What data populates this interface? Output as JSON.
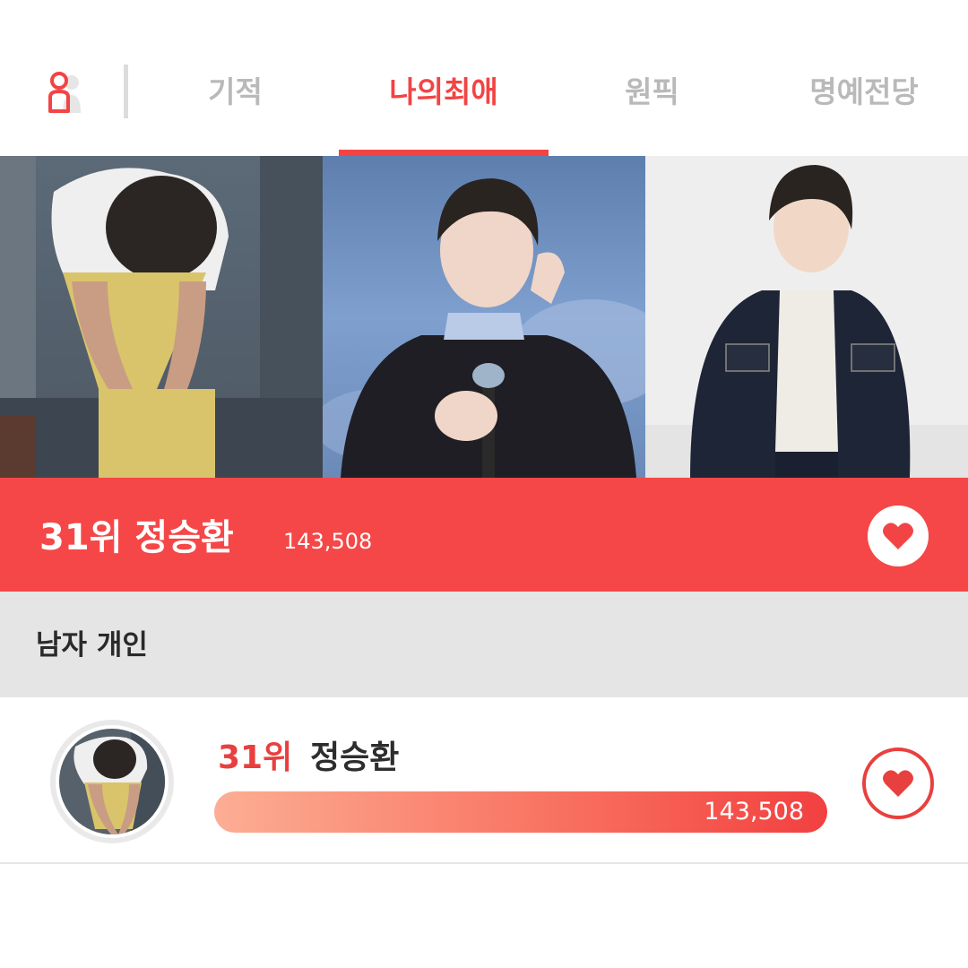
{
  "tabs": [
    {
      "label": "기적",
      "active": false
    },
    {
      "label": "나의최애",
      "active": true
    },
    {
      "label": "원픽",
      "active": false
    },
    {
      "label": "명예전당",
      "active": false
    }
  ],
  "icons": {
    "profile": "user-silhouette-icon",
    "heart": "heart-icon"
  },
  "colors": {
    "accent": "#f24444",
    "inactive_tab": "#b9b9b9",
    "section_bg": "#e5e5e5"
  },
  "banner": {
    "rank": "31위",
    "name": "정승환",
    "votes": "143,508"
  },
  "section": {
    "title": "남자 개인"
  },
  "ranking_list": [
    {
      "rank": "31위",
      "name": "정승환",
      "votes": "143,508",
      "progress": 1.0
    }
  ]
}
